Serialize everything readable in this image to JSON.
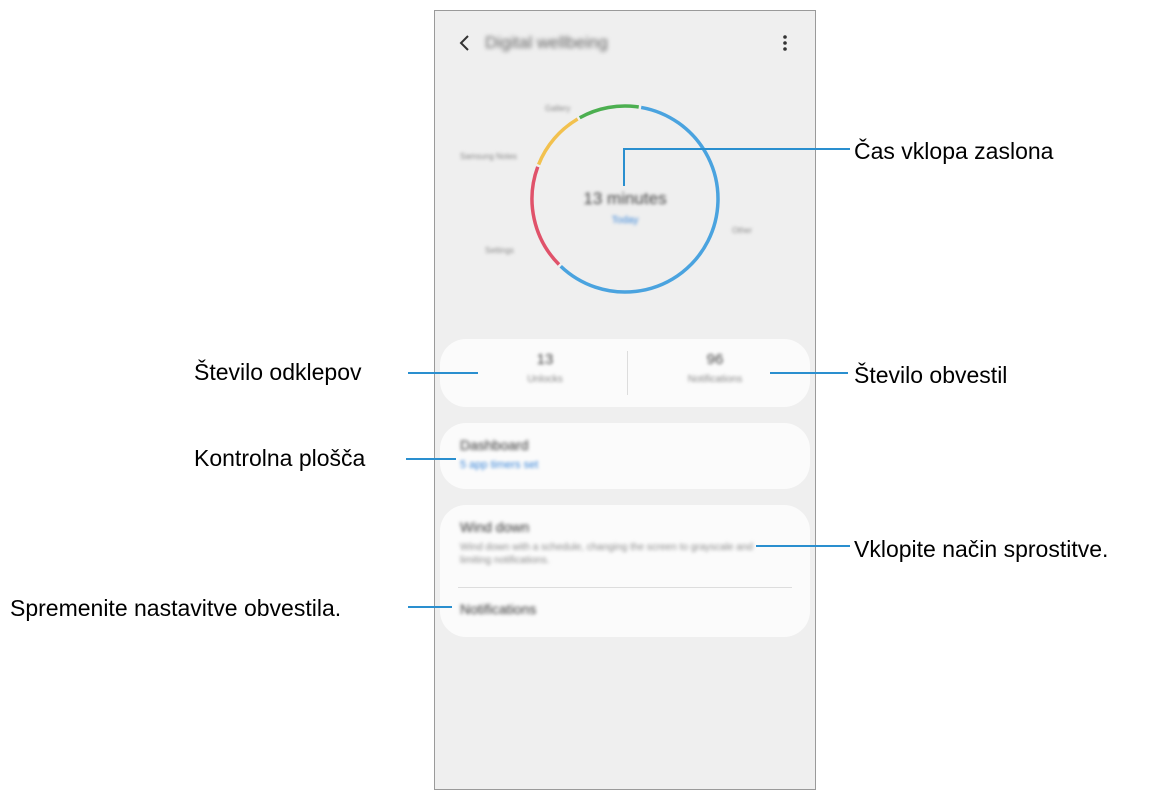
{
  "app": {
    "title": "Digital wellbeing",
    "back_icon": "back-arrow-icon",
    "more_icon": "more-vertical-icon"
  },
  "chart_data": {
    "type": "pie",
    "center_value": "13 minutes",
    "center_sublabel": "Today",
    "slices": [
      {
        "label": "Other",
        "color": "#4aa3df",
        "fraction": 0.55
      },
      {
        "label": "Settings",
        "color": "#e0526a",
        "fraction": 0.17
      },
      {
        "label": "Samsung Notes",
        "color": "#f2c14e",
        "fraction": 0.1
      },
      {
        "label": "Gallery",
        "color": "#4caf50",
        "fraction": 0.1
      },
      {
        "label": "",
        "color": "#4aa3df",
        "fraction": 0.08
      }
    ]
  },
  "stats": {
    "unlocks": {
      "value": "13",
      "label": "Unlocks"
    },
    "notifications": {
      "value": "96",
      "label": "Notifications"
    }
  },
  "dashboard": {
    "title": "Dashboard",
    "subtitle": "5 app timers set"
  },
  "wind_down": {
    "title": "Wind down",
    "description": "Wind down with a schedule, changing the screen to grayscale and limiting notifications.",
    "notifications_label": "Notifications"
  },
  "callouts": {
    "screen_time": "Čas vklopa zaslona",
    "unlocks": "Število odklepov",
    "notifications_count": "Število obvestil",
    "dashboard": "Kontrolna plošča",
    "wind_down": "Vklopite način sprostitve.",
    "notification_settings": "Spremenite nastavitve obvestila."
  },
  "colors": {
    "callout_line": "#2a8fcf",
    "accent": "#3a86d9"
  }
}
